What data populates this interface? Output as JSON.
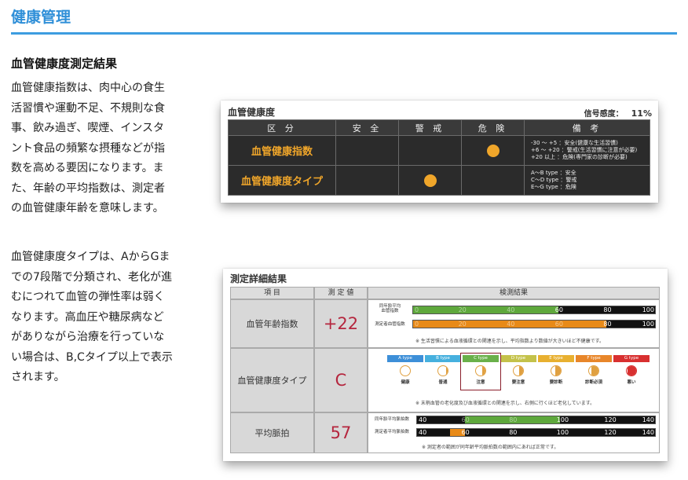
{
  "header": {
    "title": "健康管理"
  },
  "section_title": "血管健康度測定結果",
  "paragraphs": {
    "p1": [
      "血管健康指数は、肉中心の食生",
      "活習慣や運動不足、不規則な食",
      "事、飲み過ぎ、喫煙、インスタ",
      "ント食品の頻繁な摂種などが指",
      "数を高める要因になります。ま",
      "た、年齢の平均指数は、測定者",
      "の血管健康年齢を意味します。"
    ],
    "p2": [
      "血管健康度タイプは、AからGま",
      "での7段階で分類され、老化が進",
      "むにつれて血管の弾性率は弱く",
      "なります。高血圧や糖尿病など",
      "がありながら治療を行っていな",
      "い場合は、B,Cタイプ以上で表示",
      "されます。"
    ]
  },
  "card1": {
    "title": "血管健康度",
    "sensitivity_label": "信号感度：",
    "sensitivity_value": "11%",
    "headers": [
      "区 分",
      "安 全",
      "警 戒",
      "危 険",
      "備 考"
    ],
    "rows": [
      {
        "label": "血管健康指数",
        "level": "危険",
        "remarks": "-30 ～ +5 ：安全(健康な生活習慣)\n+6 ～ +20 ：警戒(生活習慣に注意が必要)\n+20 以上 ：危険(専門家の診断が必要)"
      },
      {
        "label": "血管健康度タイプ",
        "level": "警戒",
        "remarks": "A～B type ：安全\nC～D type ：警戒\nE～G type ：危険"
      }
    ],
    "dot_color": "#f0a62a"
  },
  "card2": {
    "title": "測定詳細結果",
    "headers": {
      "item": "項 目",
      "value": "測 定 値",
      "result": "検測結果"
    },
    "rows": {
      "age": {
        "label": "血管年齢指数",
        "value": "+22",
        "bar_labels": [
          "同年齢平均\n血管指数",
          "測定者血管指数"
        ],
        "ticks": [
          "0",
          "20",
          "40",
          "60",
          "80",
          "100"
        ],
        "average_level": 60,
        "measured_level": 80,
        "note": "※ 生活習慣による血液循環との関連を示し、平均指数より数値が大きいほど不健康です。"
      },
      "type": {
        "label": "血管健康度タイプ",
        "value": "C",
        "types": [
          {
            "label": "A type",
            "name": "健康",
            "color": "#3d8fd8",
            "fill": 0
          },
          {
            "label": "B type",
            "name": "普通",
            "color": "#46b0de",
            "fill": 0.15
          },
          {
            "label": "C type",
            "name": "注意",
            "color": "#6ab04a",
            "fill": 0.3
          },
          {
            "label": "D type",
            "name": "要注意",
            "color": "#c4c24a",
            "fill": 0.45
          },
          {
            "label": "E type",
            "name": "要診断",
            "color": "#e8b030",
            "fill": 0.6
          },
          {
            "label": "F type",
            "name": "診断必須",
            "color": "#e8862a",
            "fill": 0.75
          },
          {
            "label": "G type",
            "name": "悪い",
            "color": "#d83030",
            "fill": 0.9
          }
        ],
        "selected_index": 2,
        "note": "※ 末梢血管の老化度及び血液循環との関連を示し、右側に行くほど老化しています。"
      },
      "pulse": {
        "label": "平均脈拍",
        "value": "57",
        "bar_labels": [
          "同年齢平均脈拍数",
          "測定者平均脈拍数"
        ],
        "ticks": [
          "40",
          "60",
          "80",
          "100",
          "120",
          "140"
        ],
        "average_range": [
          60,
          100
        ],
        "measured_value": 57,
        "note": "※ 測定者の範囲が同年齢平均脈拍数の範囲内にあれば正常です。"
      }
    }
  }
}
